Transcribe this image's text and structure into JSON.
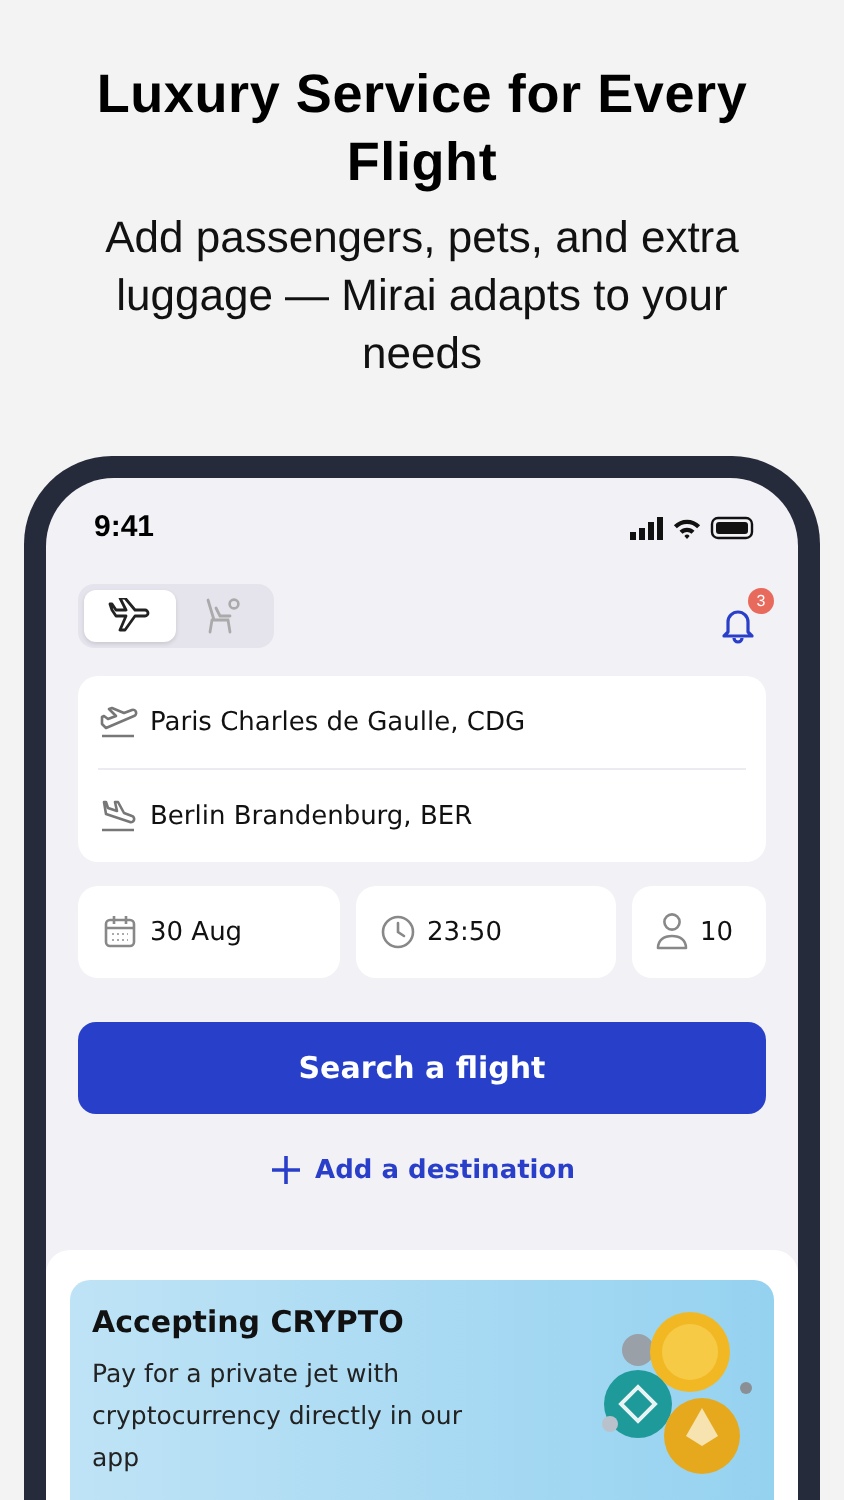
{
  "headline": "Luxury Service for Every Flight",
  "subheadline": "Add passengers, pets, and extra luggage — Mirai adapts to your needs",
  "status_bar": {
    "time": "9:41"
  },
  "mode_tabs": [
    {
      "kind": "flight",
      "selected": true
    },
    {
      "kind": "seat",
      "selected": false
    }
  ],
  "notifications": {
    "count": "3"
  },
  "route": [
    {
      "kind": "departure",
      "value": "Paris Charles de Gaulle, CDG"
    },
    {
      "kind": "arrival",
      "value": "Berlin Brandenburg, BER"
    }
  ],
  "details": [
    {
      "kind": "date",
      "value": "30 Aug"
    },
    {
      "kind": "time",
      "value": "23:50"
    },
    {
      "kind": "passengers",
      "value": "10"
    }
  ],
  "search_button": "Search a flight",
  "add_destination": "Add a destination",
  "promo": {
    "title": "Accepting CRYPTO",
    "text": "Pay for a private jet with cryptocurrency directly in our app"
  }
}
